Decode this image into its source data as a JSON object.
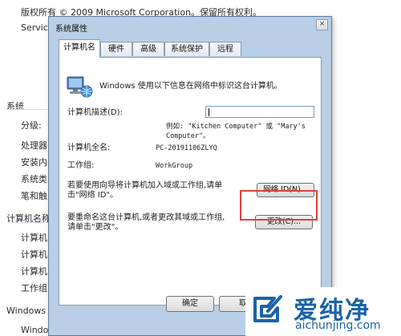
{
  "background": {
    "copyright": "版权所有 © 2009 Microsoft Corporation。保留所有权利。",
    "service": "Service",
    "system_heading": "系统",
    "rows_system": [
      "分级:",
      "处理器:",
      "安装内",
      "系统类",
      "笔和触"
    ],
    "computer_heading": "计算机名称",
    "rows_computer": [
      "计算机",
      "计算机",
      "计算机",
      "工作组:"
    ],
    "windows_heading": "Windows",
    "windows_activated": "Windows 已激活"
  },
  "dialog": {
    "title": "系统属性",
    "close_label": "×",
    "tabs": [
      "计算机名",
      "硬件",
      "高级",
      "系统保护",
      "远程"
    ],
    "intro": "Windows 使用以下信息在网络中标识这台计算机。",
    "desc_label": "计算机描述(D):",
    "desc_value": "",
    "example_line1": "例如: \"Kitchen Computer\" 或 \"Mary's",
    "example_line2": "Computer\"。",
    "fullname_label": "计算机全名:",
    "fullname_value": "PC-20191106ZLYQ",
    "workgroup_label": "工作组:",
    "workgroup_value": "WorkGroup",
    "network_hint_line1": "若要使用向导将计算机加入域或工作组,请单",
    "network_hint_line2": "击\"网络 ID\"。",
    "network_id_button": "网络 ID(N)...",
    "rename_hint_line1": "要重命名这台计算机,或者更改其域或工作组,",
    "rename_hint_line2": "请单击\"更改\"。",
    "change_button": "更改(C)...",
    "ok_button": "确定",
    "cancel_button": "取"
  },
  "watermark": {
    "text_cn": "爱纯净",
    "text_en": "aichunjing.com"
  },
  "colors": {
    "highlight": "#e2403c",
    "watermark": "#1a63a8",
    "dialog_frame": "#b9cfe6"
  }
}
